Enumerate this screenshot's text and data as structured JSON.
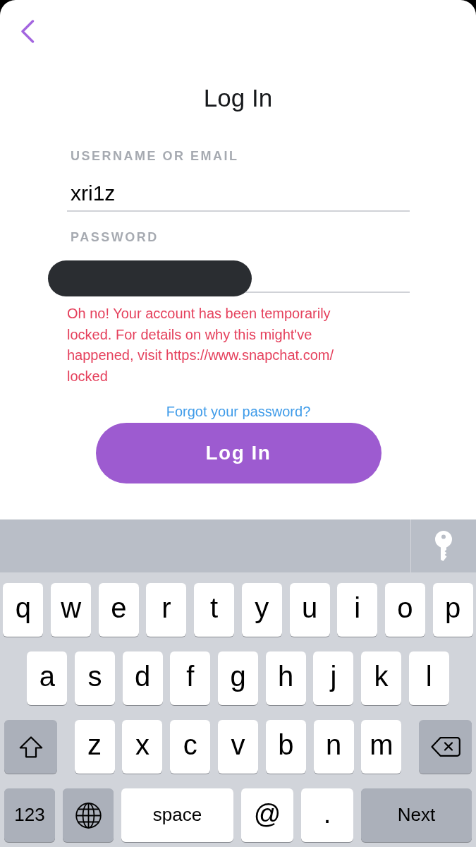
{
  "title": "Log In",
  "fields": [
    {
      "kind": "text",
      "label": "USERNAME OR EMAIL",
      "value": "xri1z"
    },
    {
      "kind": "password",
      "label": "PASSWORD",
      "redacted": true
    }
  ],
  "error_message": "Oh no! Your account has been temporarily\nlocked. For details on why this might've\nhappened, visit https://www.snapchat.com/\nlocked",
  "forgot_link": "Forgot your password?",
  "login_button": "Log In",
  "keyboard": {
    "rows": [
      {
        "keys": [
          {
            "kind": "letter",
            "label": "q"
          },
          {
            "kind": "letter",
            "label": "w"
          },
          {
            "kind": "letter",
            "label": "e"
          },
          {
            "kind": "letter",
            "label": "r"
          },
          {
            "kind": "letter",
            "label": "t"
          },
          {
            "kind": "letter",
            "label": "y"
          },
          {
            "kind": "letter",
            "label": "u"
          },
          {
            "kind": "letter",
            "label": "i"
          },
          {
            "kind": "letter",
            "label": "o"
          },
          {
            "kind": "letter",
            "label": "p"
          }
        ]
      },
      {
        "keys": [
          {
            "kind": "letter",
            "label": "a"
          },
          {
            "kind": "letter",
            "label": "s"
          },
          {
            "kind": "letter",
            "label": "d"
          },
          {
            "kind": "letter",
            "label": "f"
          },
          {
            "kind": "letter",
            "label": "g"
          },
          {
            "kind": "letter",
            "label": "h"
          },
          {
            "kind": "letter",
            "label": "j"
          },
          {
            "kind": "letter",
            "label": "k"
          },
          {
            "kind": "letter",
            "label": "l"
          }
        ]
      },
      {
        "keys": [
          {
            "kind": "shift"
          },
          {
            "kind": "letter",
            "label": "z"
          },
          {
            "kind": "letter",
            "label": "x"
          },
          {
            "kind": "letter",
            "label": "c"
          },
          {
            "kind": "letter",
            "label": "v"
          },
          {
            "kind": "letter",
            "label": "b"
          },
          {
            "kind": "letter",
            "label": "n"
          },
          {
            "kind": "letter",
            "label": "m"
          },
          {
            "kind": "delete"
          }
        ]
      },
      {
        "keys": [
          {
            "kind": "mode",
            "label": "123"
          },
          {
            "kind": "globe"
          },
          {
            "kind": "space",
            "label": "space"
          },
          {
            "kind": "symbol",
            "label": "@"
          },
          {
            "kind": "symbol",
            "label": "."
          },
          {
            "kind": "return",
            "label": "Next"
          }
        ]
      }
    ]
  }
}
